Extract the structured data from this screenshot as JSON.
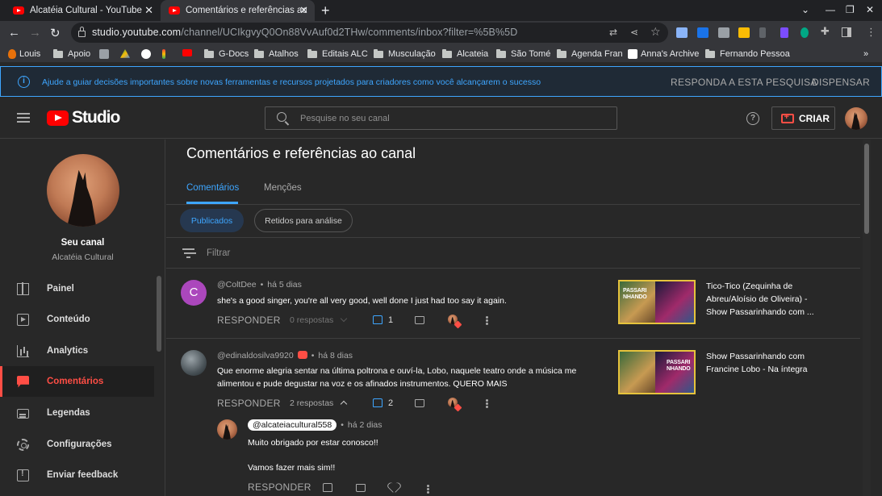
{
  "browser": {
    "tabs": [
      {
        "title": "Alcatéia Cultural - YouTube",
        "active": false
      },
      {
        "title": "Comentários e referências ao ca",
        "active": true
      }
    ],
    "url_host": "studio.youtube.com",
    "url_path": "/channel/UCIkgvyQ0On88VvAuf0d2THw/comments/inbox?filter=%5B%5D",
    "bookmarks": [
      "Louis",
      "Apoio",
      "G-Docs",
      "Atalhos",
      "Editais ALC",
      "Musculação",
      "Alcateia",
      "São Tomé",
      "Agenda Fran",
      "Anna's Archive",
      "Fernando Pessoa"
    ]
  },
  "banner": {
    "text": "Ajude a guiar decisões importantes sobre novas ferramentas e recursos projetados para criadores como você alcançarem o sucesso",
    "survey_button": "RESPONDA A ESTA PESQUISA",
    "dismiss_button": "DISPENSAR"
  },
  "header": {
    "logo_text": "Studio",
    "search_placeholder": "Pesquise no seu canal",
    "create_label": "CRIAR"
  },
  "sidebar": {
    "channel_label": "Seu canal",
    "channel_name": "Alcatéia Cultural",
    "items": [
      {
        "label": "Painel",
        "icon": "dashboard-icon",
        "active": false
      },
      {
        "label": "Conteúdo",
        "icon": "content-icon",
        "active": false
      },
      {
        "label": "Analytics",
        "icon": "analytics-icon",
        "active": false
      },
      {
        "label": "Comentários",
        "icon": "comments-icon",
        "active": true
      },
      {
        "label": "Legendas",
        "icon": "subtitles-icon",
        "active": false
      },
      {
        "label": "Configurações",
        "icon": "gear-icon",
        "active": false
      },
      {
        "label": "Enviar feedback",
        "icon": "feedback-icon",
        "active": false
      }
    ]
  },
  "main": {
    "title": "Comentários e referências ao canal",
    "tabs": [
      "Comentários",
      "Menções"
    ],
    "chips": [
      "Publicados",
      "Retidos para análise"
    ],
    "filter_placeholder": "Filtrar",
    "reply_label": "RESPONDER",
    "comments": [
      {
        "avatar_letter": "C",
        "author": "@ColtDee",
        "time": "há 5 dias",
        "text": "she's a good singer, you're all very good, well done I just had too say it again.",
        "replies": "0 respostas",
        "likes": "1",
        "video_title": "Tico-Tico (Zequinha de Abreu/Aloísio de Oliveira) - Show Passarinhando com ...",
        "thumb_text": "PASSARI NHANDO"
      },
      {
        "author": "@edinaldosilva9920",
        "time": "há 8 dias",
        "text": "Que enorme alegria sentar na última poltrona e ouví-la,  Lobo, naquele teatro onde a música me alimentou e pude degustar na voz e os afinados instrumentos. QUERO MAIS",
        "replies": "2 respostas",
        "likes": "2",
        "video_title": "Show Passarinhando com Francine Lobo - Na íntegra",
        "thumb_text": "PASSARI NHANDO"
      }
    ],
    "reply": {
      "author": "@alcateiacultural558",
      "time": "há 2 dias",
      "line1": "Muito obrigado por estar conosco!!",
      "line2": "Vamos fazer mais sim!!"
    }
  },
  "colors": {
    "accent_blue": "#3ea6ff",
    "accent_red": "#ff4e45",
    "background": "#282828"
  }
}
